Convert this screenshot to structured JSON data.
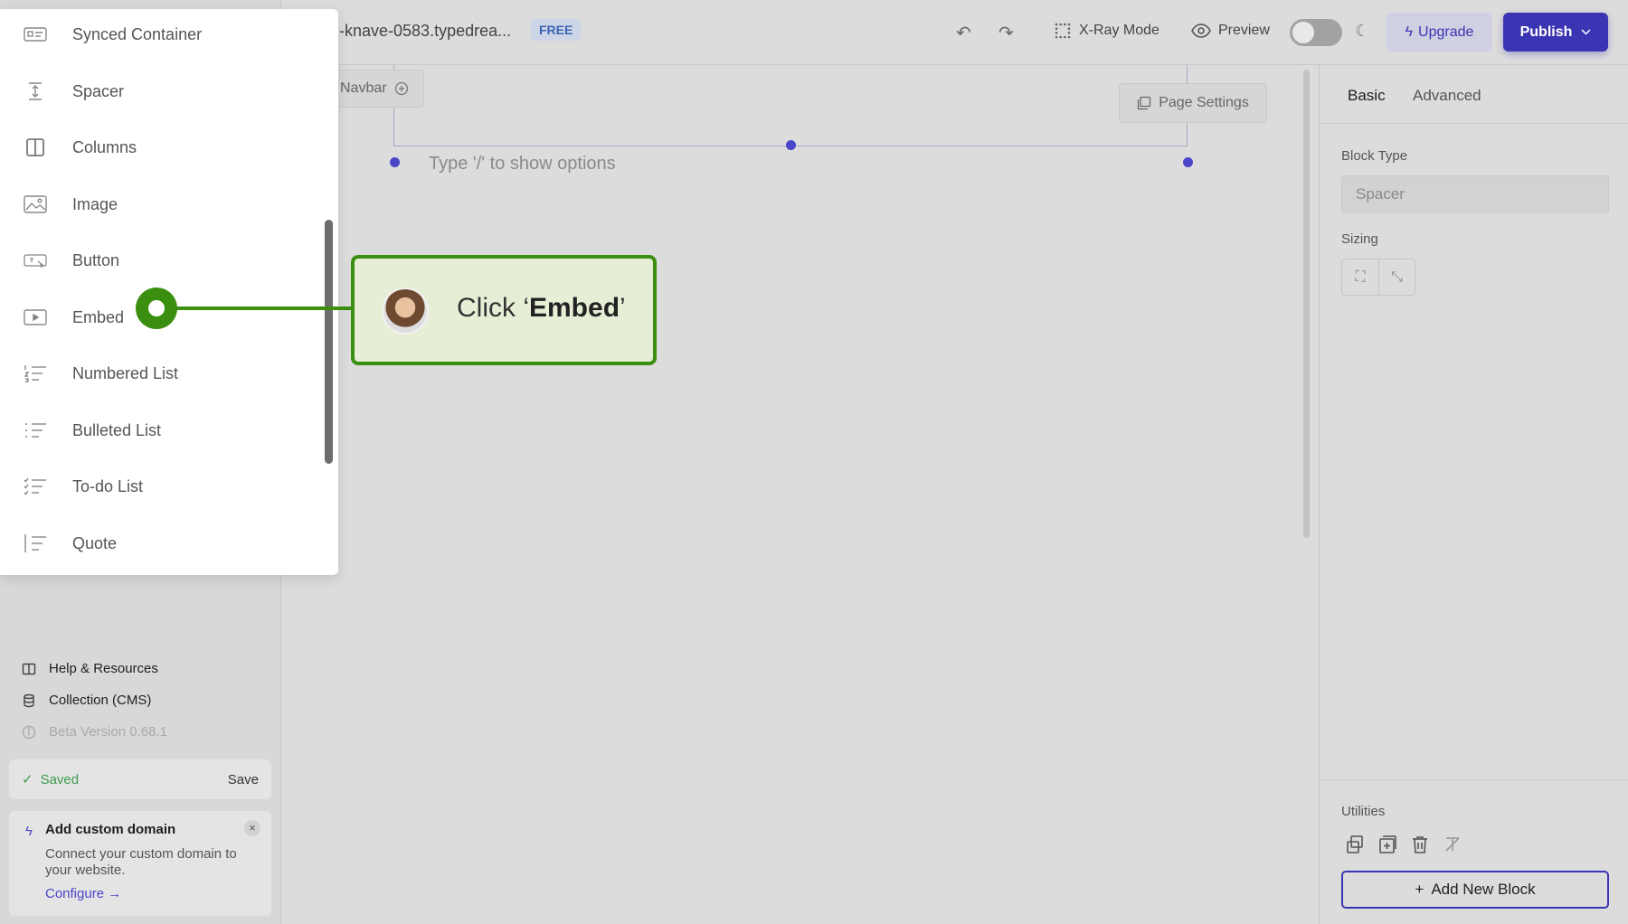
{
  "topbar": {
    "site_name": "-knave-0583.typedrea...",
    "plan_badge": "FREE",
    "xray_label": "X-Ray Mode",
    "preview_label": "Preview",
    "upgrade_label": "Upgrade",
    "publish_label": "Publish",
    "dark_mode_enabled": false
  },
  "canvas": {
    "navbar_label": "Navbar",
    "page_settings_label": "Page Settings",
    "placeholder": "Type '/' to show options"
  },
  "block_menu": {
    "items": [
      {
        "label": "Synced Container",
        "icon": "synced-container-icon"
      },
      {
        "label": "Spacer",
        "icon": "spacer-icon"
      },
      {
        "label": "Columns",
        "icon": "columns-icon"
      },
      {
        "label": "Image",
        "icon": "image-icon"
      },
      {
        "label": "Button",
        "icon": "button-icon"
      },
      {
        "label": "Embed",
        "icon": "embed-icon"
      },
      {
        "label": "Numbered List",
        "icon": "numbered-list-icon"
      },
      {
        "label": "Bulleted List",
        "icon": "bulleted-list-icon"
      },
      {
        "label": "To-do List",
        "icon": "todo-list-icon"
      },
      {
        "label": "Quote",
        "icon": "quote-icon"
      }
    ]
  },
  "guide": {
    "prefix": "Click ‘",
    "target": "Embed",
    "suffix": "’"
  },
  "sidebar": {
    "help_label": "Help & Resources",
    "collection_label": "Collection (CMS)",
    "version_label": "Beta Version 0.68.1",
    "saved_label": "Saved",
    "save_button": "Save",
    "domain_title": "Add custom domain",
    "domain_desc": "Connect your custom domain to your website.",
    "domain_link": "Configure →"
  },
  "right_panel": {
    "tab_basic": "Basic",
    "tab_advanced": "Advanced",
    "block_type_label": "Block Type",
    "block_type_value": "Spacer",
    "sizing_label": "Sizing",
    "utilities_label": "Utilities",
    "add_block_label": "Add New Block"
  },
  "colors": {
    "accent": "#3b35b4",
    "guide_green": "#3b8f10",
    "saved_green": "#3c9b4f"
  }
}
